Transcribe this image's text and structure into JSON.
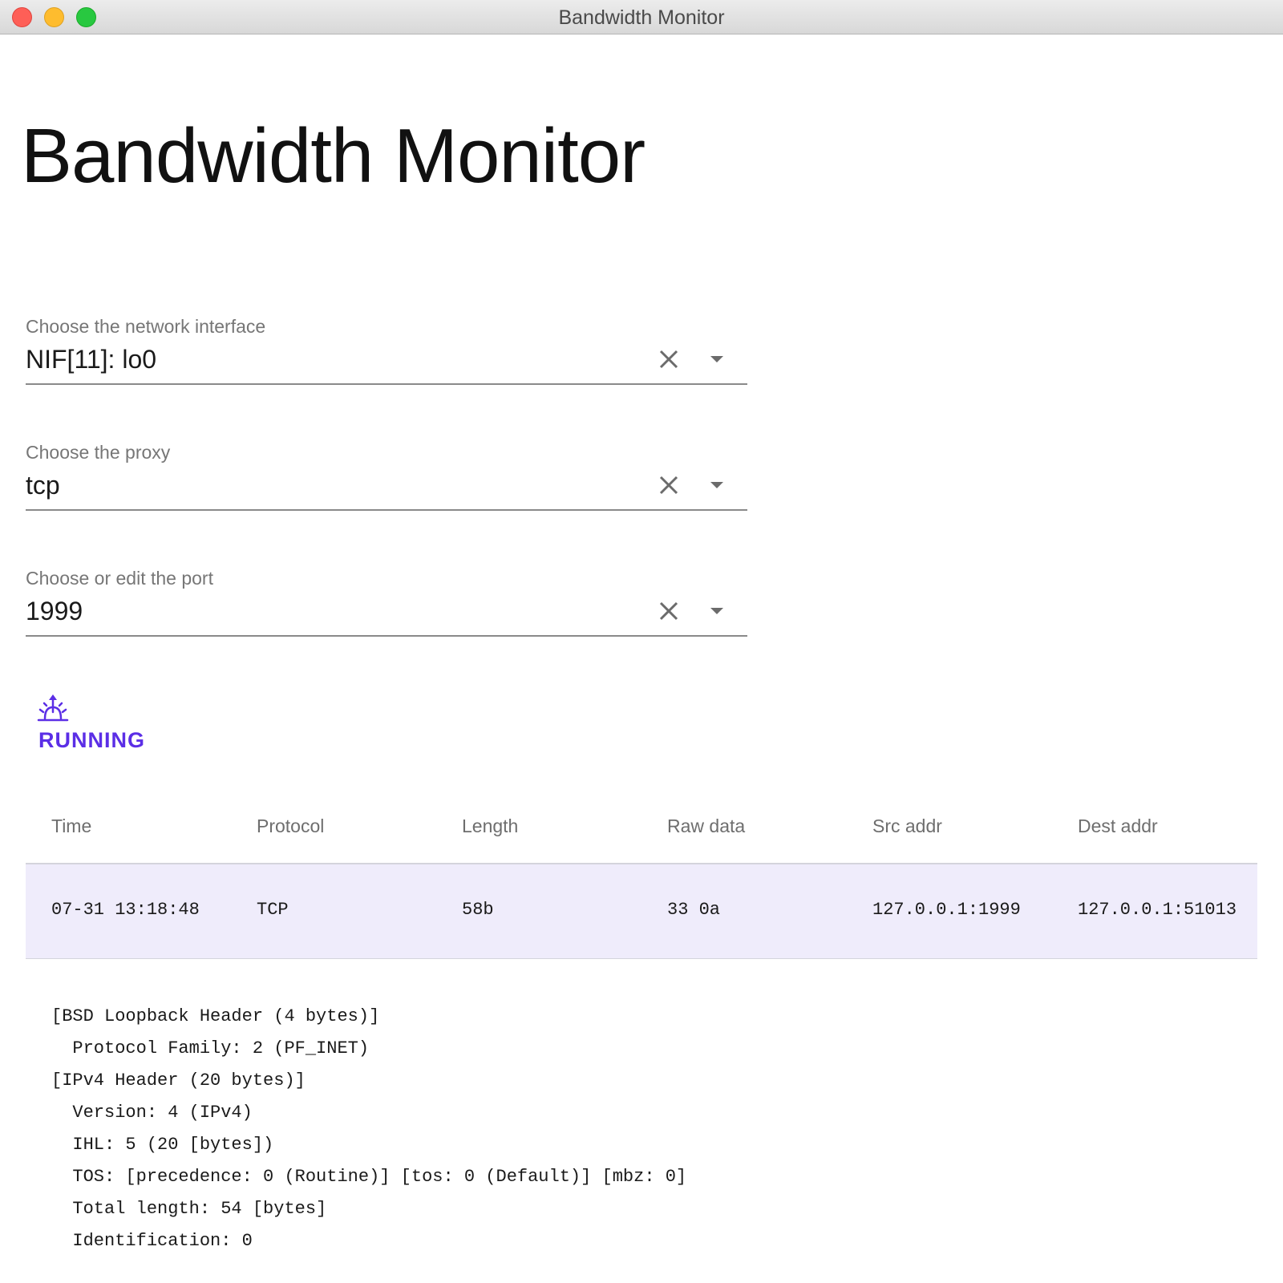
{
  "window": {
    "title": "Bandwidth Monitor"
  },
  "page": {
    "title": "Bandwidth Monitor"
  },
  "fields": [
    {
      "label": "Choose the network interface",
      "value": "NIF[11]: lo0"
    },
    {
      "label": "Choose the proxy",
      "value": "tcp"
    },
    {
      "label": "Choose or edit the port",
      "value": "1999"
    }
  ],
  "run_button": {
    "label": "RUNNING",
    "icon": "radar-icon",
    "color": "#5b2ee6"
  },
  "table": {
    "headers": [
      "Time",
      "Protocol",
      "Length",
      "Raw data",
      "Src addr",
      "Dest addr"
    ],
    "rows": [
      [
        "07-31 13:18:48",
        "TCP",
        "58b",
        "33 0a",
        "127.0.0.1:1999",
        "127.0.0.1:51013"
      ]
    ],
    "selected_row_color": "#efecfb"
  },
  "details": [
    "[BSD Loopback Header (4 bytes)]",
    "  Protocol Family: 2 (PF_INET)",
    "[IPv4 Header (20 bytes)]",
    "  Version: 4 (IPv4)",
    "  IHL: 5 (20 [bytes])",
    "  TOS: [precedence: 0 (Routine)] [tos: 0 (Default)] [mbz: 0]",
    "  Total length: 54 [bytes]",
    "  Identification: 0"
  ]
}
